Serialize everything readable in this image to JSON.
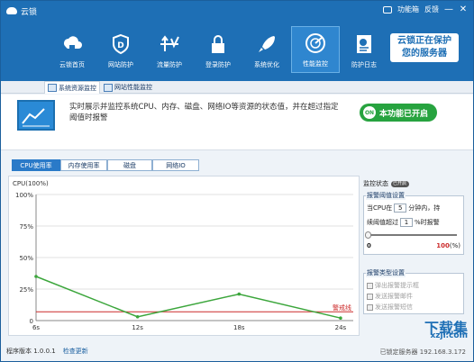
{
  "window": {
    "title": "云锁",
    "menu_label": "功能箱",
    "feedback_label": "反馈",
    "min_symbol": "—",
    "close_symbol": "✕"
  },
  "nav": {
    "items": [
      {
        "label": "云锁首页",
        "icon": "cloud-lock-icon"
      },
      {
        "label": "网站防护",
        "icon": "shield-d-icon"
      },
      {
        "label": "流量防护",
        "icon": "traffic-icon"
      },
      {
        "label": "登录防护",
        "icon": "padlock-icon"
      },
      {
        "label": "系统优化",
        "icon": "rocket-icon"
      },
      {
        "label": "性能监控",
        "icon": "radar-icon",
        "active": true
      },
      {
        "label": "防护日志",
        "icon": "report-icon"
      }
    ],
    "protect_badge_line1": "云锁正在保护",
    "protect_badge_line2": "您的服务器"
  },
  "subtabs": [
    "系统资源监控",
    "网站性能监控"
  ],
  "intro": {
    "description": "实时展示并监控系统CPU、内存、磁盘、网络IO等资源的状态值，并在超过指定阈值时报警",
    "switch_label": "本功能已开启",
    "switch_knob": "ON"
  },
  "metric_tabs": [
    "CPU使用率",
    "内存使用率",
    "磁盘",
    "网络IO"
  ],
  "chart_data": {
    "type": "line",
    "title": "CPU(100%)",
    "x": [
      "6s",
      "12s",
      "18s",
      "24s"
    ],
    "y_ticks": [
      "100%",
      "75%",
      "50%",
      "25%",
      "0"
    ],
    "ylim": [
      0,
      100
    ],
    "series": [
      {
        "values": [
          35,
          3,
          21,
          2
        ],
        "color": "#3ca63c"
      }
    ],
    "threshold": {
      "label": "警戒线",
      "value": 7,
      "color": "#cc2a2a"
    },
    "grid": true
  },
  "side": {
    "monitor_status_label": "监控状态",
    "toggle_label": "已开启",
    "threshold_group": "报警阈值设置",
    "row1_prefix": "当CPU在",
    "row1_value": "5",
    "row1_suffix": "分钟内，持",
    "row2_prefix": "续阈值超过",
    "row2_value": "1",
    "row2_suffix": "%时报警",
    "slider_min": "0",
    "slider_max": "100",
    "slider_unit": "(%)",
    "alert_group": "报警类型设置",
    "alerts": [
      "弹出报警提示框",
      "发送报警邮件",
      "发送报警短信"
    ]
  },
  "status": {
    "version": "程序版本 1.0.0.1",
    "update": "检查更新",
    "ip": "已锁定服务器 192.168.3.172"
  },
  "watermark": {
    "line1": "下载集",
    "line2": "xzji.com"
  }
}
